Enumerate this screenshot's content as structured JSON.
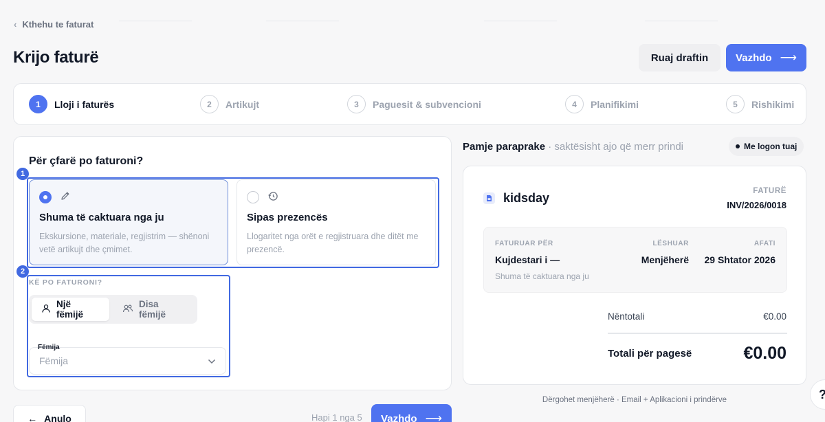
{
  "nav": {
    "back_label": "Kthehu te faturat"
  },
  "header": {
    "title": "Krijo faturë",
    "save_draft_label": "Ruaj draftin",
    "continue_label": "Vazhdo"
  },
  "stepper": {
    "steps": [
      {
        "number": "1",
        "label": "Lloji i faturës",
        "active": true
      },
      {
        "number": "2",
        "label": "Artikujt",
        "active": false
      },
      {
        "number": "3",
        "label": "Paguesit & subvencioni",
        "active": false
      },
      {
        "number": "4",
        "label": "Planifikimi",
        "active": false
      },
      {
        "number": "5",
        "label": "Rishikimi",
        "active": false
      }
    ]
  },
  "form": {
    "question": "Për çfarë po faturoni?",
    "markers": [
      "1",
      "2"
    ],
    "options": [
      {
        "title": "Shuma të caktuara nga ju",
        "description": "Ekskursione, materiale, regjistrim — shënoni vetë artikujt dhe çmimet.",
        "selected": true,
        "icon": "pencil-icon"
      },
      {
        "title": "Sipas prezencës",
        "description": "Llogaritet nga orët e regjistruara dhe ditët me prezencë.",
        "selected": false,
        "icon": "history-clock-icon"
      }
    ],
    "recipient_question": "KË PO FATURONI?",
    "recipient_options": [
      {
        "label": "Një fëmijë",
        "selected": true,
        "icon": "user-icon"
      },
      {
        "label": "Disa fëmijë",
        "selected": false,
        "icon": "users-icon"
      }
    ],
    "child_field": {
      "label": "Fëmija",
      "placeholder": "Fëmija"
    }
  },
  "preview": {
    "title": "Pamje paraprake",
    "subtitle": "· saktësisht ajo që merr prindi",
    "logo_toggle": "Me logon tuaj",
    "brand": "kidsday",
    "doc_type": "FATURË",
    "invoice_number": "INV/2026/0018",
    "billed_to_label": "FATURUAR PËR",
    "billed_to_value": "Kujdestari i —",
    "billed_to_note": "Shuma të caktuara nga ju",
    "issued_label": "LËSHUAR",
    "issued_value": "Menjëherë",
    "due_label": "AFATI",
    "due_value": "29 Shtator 2026",
    "subtotal_label": "Nëntotali",
    "subtotal_value": "€0.00",
    "total_label": "Totali për pagesë",
    "total_value": "€0.00",
    "delivery_note": "Dërgohet menjëherë · Email + Aplikacioni i prindërve"
  },
  "footer": {
    "cancel_label": "Anulo",
    "step_count": "Hapi 1 nga 5",
    "continue_label": "Vazhdo"
  },
  "help": {
    "label": "?"
  },
  "colors": {
    "accent": "#4f73f0",
    "highlight": "#4169e1",
    "muted": "#9ca3af"
  }
}
